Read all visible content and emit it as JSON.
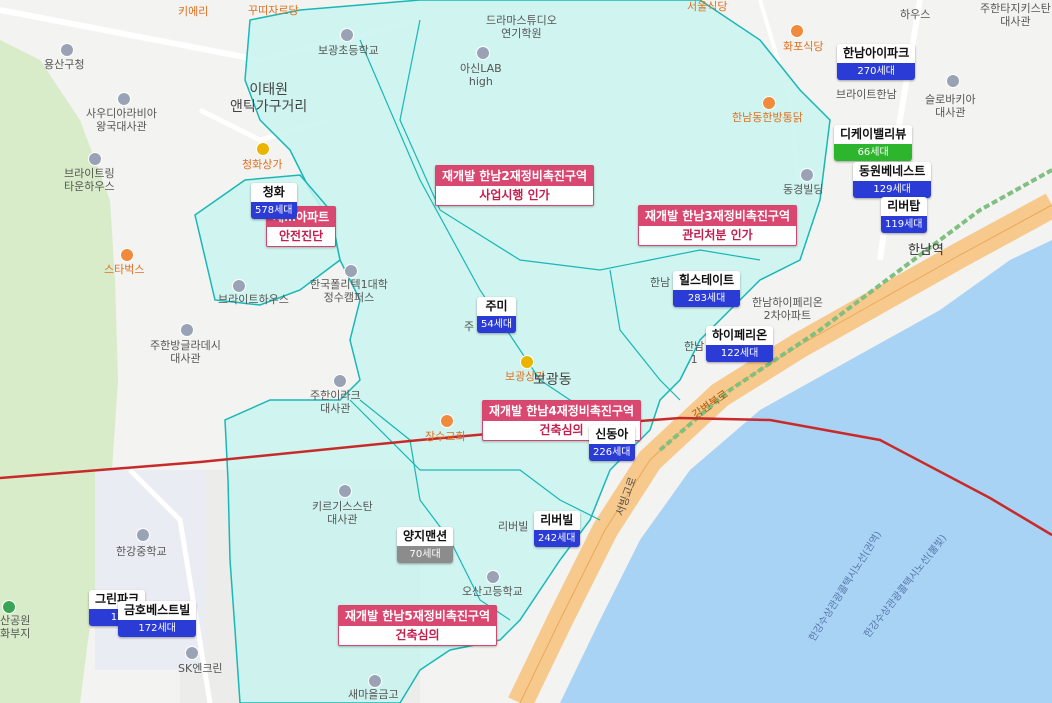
{
  "colors": {
    "zone_fill": "#c9f3ef",
    "zone_stroke": "#19b7b7",
    "river": "#a9d3f5",
    "road": "#f7c98d",
    "boundary_line": "#c82a2a",
    "marker_blue": "#2a3bd6",
    "marker_green": "#2db52d",
    "marker_gray": "#8c8c8c",
    "zone_label_pink": "#d94870"
  },
  "markers": [
    {
      "name": "청화",
      "count": "578세대",
      "color": "blue"
    },
    {
      "name": "주미",
      "count": "54세대",
      "color": "blue"
    },
    {
      "name": "힐스테이트",
      "count": "283세대",
      "color": "blue"
    },
    {
      "name": "하이페리온",
      "count": "122세대",
      "color": "blue"
    },
    {
      "name": "신동아",
      "count": "226세대",
      "color": "blue"
    },
    {
      "name": "리버빌",
      "count": "242세대",
      "color": "blue"
    },
    {
      "name": "양지맨션",
      "count": "70세대",
      "color": "gray"
    },
    {
      "name": "그린파크",
      "count": "12",
      "color": "blue"
    },
    {
      "name": "금호베스트빌",
      "count": "172세대",
      "color": "blue"
    },
    {
      "name": "한남아이파크",
      "count": "270세대",
      "color": "blue"
    },
    {
      "name": "디케이밸리뷰",
      "count": "66세대",
      "color": "green"
    },
    {
      "name": "동원베네스트",
      "count": "129세대",
      "color": "blue"
    },
    {
      "name": "리버탑",
      "count": "119세대",
      "color": "blue"
    }
  ],
  "zones": [
    {
      "title": "재개발 한남2재정비촉진구역",
      "status": "사업시행 인가"
    },
    {
      "title": "재개발 한남3재정비촉진구역",
      "status": "관리처분 인가"
    },
    {
      "title": "재개발 한남4재정비촉진구역",
      "status": "건축심의"
    },
    {
      "title": "재개발 한남5재정비촉진구역",
      "status": "건축심의"
    },
    {
      "title": "재…아파트",
      "status": "안전진단"
    }
  ],
  "places": {
    "itaewon": "이태원\n앤틱가구거리",
    "bogwang_elem": "보광초등학교",
    "ashin_lab": "아신LAB\nhigh",
    "drama_studio": "드라마스튜디오\n연기학원",
    "yongsan_office": "용산구청",
    "saudi_embassy": "사우디아라비아\n왕국대사관",
    "brightling": "브라이트링\n타운하우스",
    "starbucks": "스타벅스",
    "cheonghwa_mall": "청화상가",
    "polytech": "한국폴리텍1대학\n정수캠퍼스",
    "bright_house": "브라이트하우스",
    "guatemala_embassy": "주한방글라데시\n대사관",
    "iraq_embassy": "주한이라크\n대사관",
    "kyrgyz_embassy": "키르기스스탄\n대사관",
    "hannam_middle": "한강중학교",
    "hwapo": "화포식당",
    "hannam_dong_chicken": "한남동한방통닭",
    "donggyeong": "동경빌딩",
    "bright_hannam": "브라이트한남",
    "slovakia": "슬로바키아\n대사관",
    "hannam_station": "한남역",
    "bogwang_mall": "보광상가",
    "bogwang_dong": "보광동",
    "jangsu_mall": "장수교회",
    "osan_high": "오산고등학교",
    "saemaeul": "새마을금고",
    "sk": "SK엔크린",
    "gangbyeon": "강변북로",
    "seobinggo": "서빙고로",
    "hannam_hyperion": "한남하이페리온\n2차아파트",
    "river_route1": "한강수상관광콜택시노선(권역)",
    "river_route2": "한강수상관광콜택시노선(불빛)",
    "park": "산공원\n화부지",
    "top_label1": "키에리",
    "top_label2": "꾸띠자르당",
    "top_label3": "서울식당",
    "top_label4": "하우스",
    "top_label5": "주한타지키스탄\n대사관",
    "hannam_1": "한남\n1",
    "ju": "주",
    "liberty": "리버빌",
    "han": "한남"
  }
}
